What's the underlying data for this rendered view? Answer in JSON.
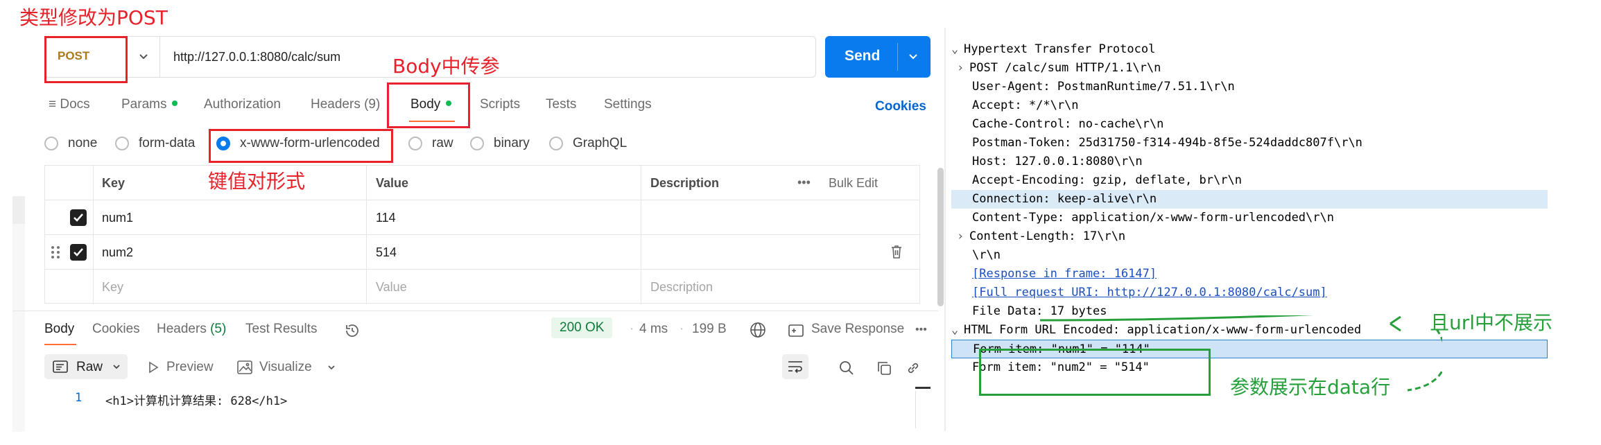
{
  "annotations": {
    "method_note": "类型修改为POST",
    "body_note": "Body中传参",
    "kv_note": "键值对形式",
    "url_note": "且url中不展示",
    "data_note": "参数展示在data行"
  },
  "request": {
    "method": "POST",
    "url": "http://127.0.0.1:8080/calc/sum",
    "send_label": "Send"
  },
  "request_tabs": [
    {
      "label": "Docs"
    },
    {
      "label": "Params"
    },
    {
      "label": "Authorization"
    },
    {
      "label": "Headers (9)"
    },
    {
      "label": "Body"
    },
    {
      "label": "Scripts"
    },
    {
      "label": "Tests"
    },
    {
      "label": "Settings"
    }
  ],
  "cookies_label": "Cookies",
  "body_types": [
    {
      "label": "none",
      "selected": false
    },
    {
      "label": "form-data",
      "selected": false
    },
    {
      "label": "x-www-form-urlencoded",
      "selected": true
    },
    {
      "label": "raw",
      "selected": false
    },
    {
      "label": "binary",
      "selected": false
    },
    {
      "label": "GraphQL",
      "selected": false
    }
  ],
  "kv_table": {
    "headers": {
      "key": "Key",
      "value": "Value",
      "description": "Description",
      "bulk_edit": "Bulk Edit",
      "more": "•••"
    },
    "rows": [
      {
        "key": "num1",
        "value": "114",
        "description": "",
        "checked": true
      },
      {
        "key": "num2",
        "value": "514",
        "description": "",
        "checked": true
      }
    ],
    "placeholder": {
      "key": "Key",
      "value": "Value",
      "description": "Description"
    }
  },
  "response": {
    "tabs": [
      {
        "label": "Body"
      },
      {
        "label": "Cookies"
      },
      {
        "label": "Headers",
        "count": "(5)"
      },
      {
        "label": "Test Results"
      }
    ],
    "status": "200 OK",
    "time": "4 ms",
    "size": "199 B",
    "save_label": "Save Response",
    "more": "•••",
    "format": "Raw",
    "preview_label": "Preview",
    "visualize_label": "Visualize",
    "line_number": "1",
    "body_line": "<h1>计算机计算结果: 628</h1>"
  },
  "wireshark": {
    "lines": [
      {
        "text": "Hypertext Transfer Protocol",
        "indent": 0,
        "arrow": "⌄",
        "style": ""
      },
      {
        "text": "POST /calc/sum HTTP/1.1\\r\\n",
        "indent": 1,
        "arrow": "›",
        "style": ""
      },
      {
        "text": "User-Agent: PostmanRuntime/7.51.1\\r\\n",
        "indent": 1,
        "arrow": "",
        "style": ""
      },
      {
        "text": "Accept: */*\\r\\n",
        "indent": 1,
        "arrow": "",
        "style": ""
      },
      {
        "text": "Cache-Control: no-cache\\r\\n",
        "indent": 1,
        "arrow": "",
        "style": ""
      },
      {
        "text": "Postman-Token: 25d31750-f314-494b-8f5e-524daddc807f\\r\\n",
        "indent": 1,
        "arrow": "",
        "style": ""
      },
      {
        "text": "Host: 127.0.0.1:8080\\r\\n",
        "indent": 1,
        "arrow": "",
        "style": ""
      },
      {
        "text": "Accept-Encoding: gzip, deflate, br\\r\\n",
        "indent": 1,
        "arrow": "",
        "style": ""
      },
      {
        "text": "Connection: keep-alive\\r\\n",
        "indent": 1,
        "arrow": "",
        "style": "hl"
      },
      {
        "text": "Content-Type: application/x-www-form-urlencoded\\r\\n",
        "indent": 1,
        "arrow": "",
        "style": ""
      },
      {
        "text": "Content-Length: 17\\r\\n",
        "indent": 1,
        "arrow": "›",
        "style": ""
      },
      {
        "text": "\\r\\n",
        "indent": 1,
        "arrow": "",
        "style": ""
      },
      {
        "text": "[Response in frame: 16147]",
        "indent": 1,
        "arrow": "",
        "style": "link"
      },
      {
        "text": "[Full request URI: http://127.0.0.1:8080/calc/sum]",
        "indent": 1,
        "arrow": "",
        "style": "link"
      },
      {
        "text": "File Data: 17 bytes",
        "indent": 1,
        "arrow": "",
        "style": ""
      },
      {
        "text": "HTML Form URL Encoded: application/x-www-form-urlencoded",
        "indent": 0,
        "arrow": "⌄",
        "style": ""
      },
      {
        "text": "Form item: \"num1\" = \"114\"",
        "indent": 1,
        "arrow": "",
        "style": "hl2"
      },
      {
        "text": "Form item: \"num2\" = \"514\"",
        "indent": 1,
        "arrow": "",
        "style": ""
      }
    ]
  },
  "colors": {
    "send": "#097bed",
    "accent": "#ff6c37",
    "annotation_red": "#e8222a",
    "annotation_green": "#27a03b"
  }
}
